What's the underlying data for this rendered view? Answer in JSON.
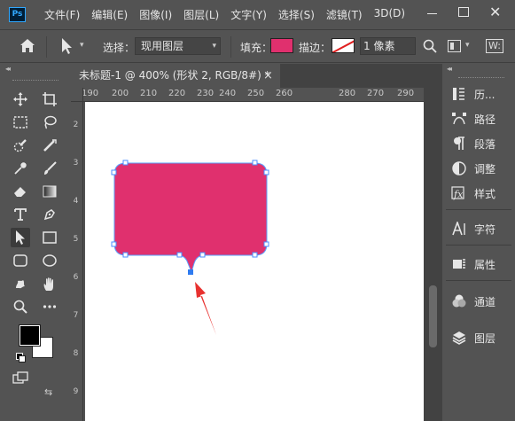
{
  "app": {
    "logo": "Ps",
    "menu": [
      "文件(F)",
      "编辑(E)",
      "图像(I)",
      "图层(L)",
      "文字(Y)",
      "选择(S)",
      "滤镜(T)",
      "3D(D)"
    ]
  },
  "options_bar": {
    "select_label": "选择：",
    "select_value": "现用图层",
    "fill_label": "填充：",
    "fill_color": "#e0306e",
    "stroke_label": "描边：",
    "stroke_width": "1 像素",
    "w_label": "W:"
  },
  "document": {
    "tab_title": "未标题-1 @ 400% (形状 2, RGB/8#) *",
    "close_glyph": "×",
    "ruler_h_labels": [
      "190",
      "200",
      "210",
      "220",
      "230",
      "240",
      "250",
      "260",
      "270",
      "280",
      "290"
    ],
    "ruler_v_labels": [
      "2",
      "3",
      "4",
      "5",
      "6",
      "7",
      "8",
      "9"
    ],
    "shape_color": "#e0306e",
    "annotation_color": "#e8312f"
  },
  "tools": {
    "foreground_color": "#000000",
    "background_color": "#ffffff"
  },
  "right_panel": {
    "items": [
      {
        "icon": "history-icon",
        "label": "历..."
      },
      {
        "icon": "paths-icon",
        "label": "路径"
      },
      {
        "icon": "paragraph-icon",
        "label": "段落"
      },
      {
        "icon": "adjustments-icon",
        "label": "调整"
      },
      {
        "icon": "styles-icon",
        "label": "样式"
      },
      {
        "icon": "character-icon",
        "label": "字符"
      },
      {
        "icon": "properties-icon",
        "label": "属性"
      },
      {
        "icon": "channels-icon",
        "label": "通道"
      },
      {
        "icon": "layers-icon",
        "label": "图层"
      }
    ]
  }
}
